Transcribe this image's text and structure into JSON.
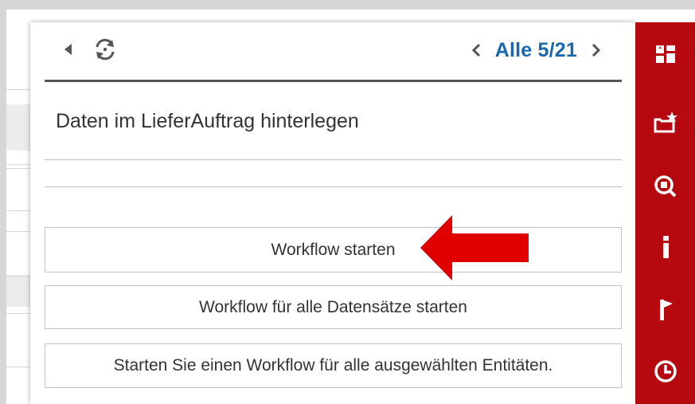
{
  "toolbar": {
    "back_icon": "back-triangle-icon",
    "refresh_icon": "refresh-icon",
    "pager": {
      "label": "Alle 5/21",
      "prev_icon": "chevron-left-icon",
      "next_icon": "chevron-right-icon"
    }
  },
  "panel": {
    "title": "Daten im LieferAuftrag hinterlegen"
  },
  "actions": [
    {
      "label": "Workflow starten"
    },
    {
      "label": "Workflow für alle Datensätze starten"
    },
    {
      "label": "Starten Sie einen Workflow für alle ausgewählten Entitäten."
    }
  ],
  "annotation": {
    "color": "#e00000"
  },
  "sidebar": {
    "color": "#b5080f",
    "icons": [
      "dashboard-icon",
      "folder-star-icon",
      "search-icon",
      "info-icon",
      "flag-icon",
      "clock-icon"
    ]
  },
  "colors": {
    "accent": "#1a67b0",
    "text": "#333333"
  }
}
